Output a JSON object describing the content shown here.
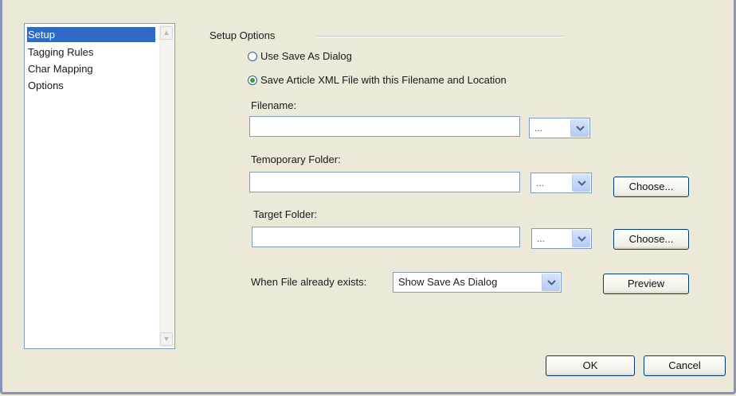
{
  "sidebar": {
    "items": [
      {
        "label": "Setup",
        "selected": true
      },
      {
        "label": "Tagging Rules",
        "selected": false
      },
      {
        "label": "Char Mapping",
        "selected": false
      },
      {
        "label": "Options",
        "selected": false
      }
    ]
  },
  "setup": {
    "group_title": "Setup Options",
    "radio_use_dialog": "Use Save As Dialog",
    "radio_save_article": "Save Article XML File with this Filename and Location",
    "selected_radio": "radio_save_article",
    "filename": {
      "label": "Filename:",
      "value": "",
      "combo_value": "..."
    },
    "temp_folder": {
      "label": "Temoporary Folder:",
      "value": "",
      "combo_value": "...",
      "choose_label": "Choose..."
    },
    "target_folder": {
      "label": "Target Folder:",
      "value": "",
      "combo_value": "...",
      "choose_label": "Choose..."
    },
    "exists": {
      "label": "When File already exists:",
      "value": "Show Save As Dialog"
    },
    "preview_label": "Preview"
  },
  "footer": {
    "ok_label": "OK",
    "cancel_label": "Cancel"
  },
  "colors": {
    "selection": "#316ac5",
    "background": "#ece9d8",
    "border": "#7f9db9",
    "button_border": "#003c74"
  },
  "icons": {
    "combo_arrow": "chevron-down-icon",
    "scroll_up": "scroll-up-arrow-icon",
    "scroll_down": "scroll-down-arrow-icon"
  }
}
